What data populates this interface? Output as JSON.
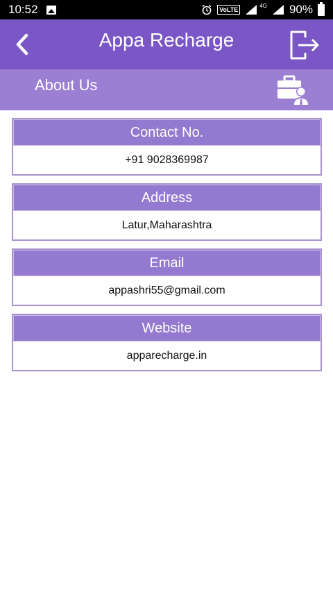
{
  "status_bar": {
    "time": "10:52",
    "network": "4G",
    "volte": "VoLTE",
    "battery": "90%"
  },
  "app_bar": {
    "title": "Appa Recharge",
    "back_icon": "chevron-left-icon",
    "logout_icon": "logout-icon"
  },
  "sub_header": {
    "title": "About Us",
    "icon": "briefcase-user-icon"
  },
  "cards": [
    {
      "label": "Contact No.",
      "value": "+91 9028369987"
    },
    {
      "label": "Address",
      "value": "Latur,Maharashtra"
    },
    {
      "label": "Email",
      "value": "appashri55@gmail.com"
    },
    {
      "label": "Website",
      "value": "apparecharge.in"
    }
  ],
  "colors": {
    "app_bar": "#7b56c6",
    "sub_header": "#9b7fd3",
    "card_header": "#9379cf",
    "card_border": "#a792cf"
  }
}
